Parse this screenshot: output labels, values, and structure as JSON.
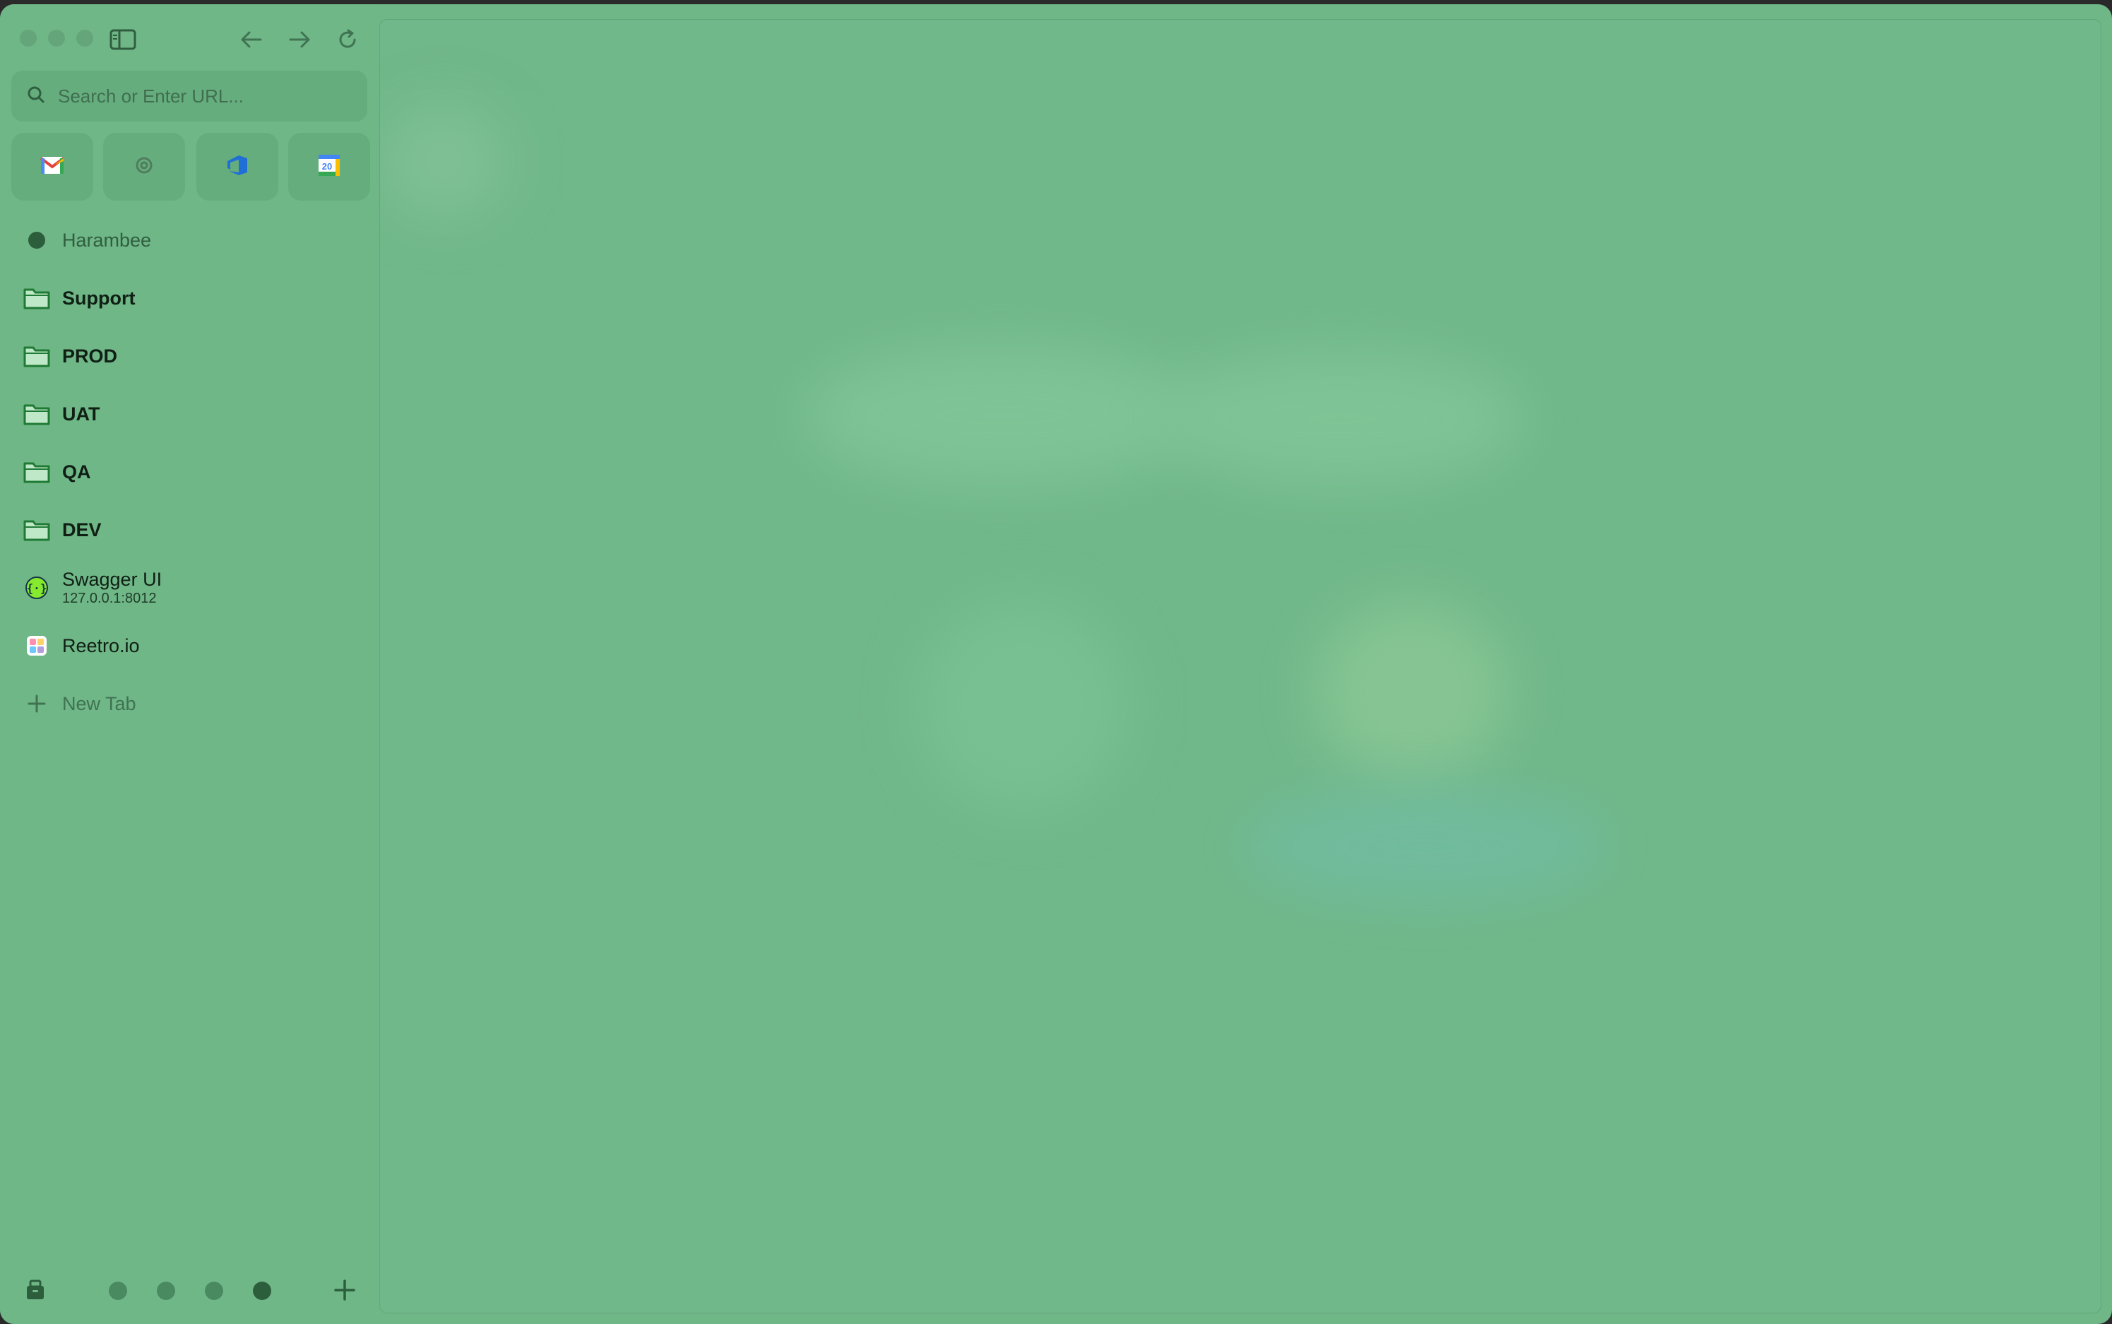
{
  "search": {
    "placeholder": "Search or Enter URL..."
  },
  "sidebar": {
    "items": [
      {
        "label": "Harambee",
        "icon": "space-dot-icon"
      },
      {
        "label": "Support",
        "icon": "folder-icon"
      },
      {
        "label": "PROD",
        "icon": "folder-icon"
      },
      {
        "label": "UAT",
        "icon": "folder-icon"
      },
      {
        "label": "QA",
        "icon": "folder-icon"
      },
      {
        "label": "DEV",
        "icon": "folder-icon"
      },
      {
        "label": "Swagger UI",
        "sublabel": "127.0.0.1:8012",
        "icon": "swagger-icon"
      },
      {
        "label": "Reetro.io",
        "icon": "reetro-icon"
      },
      {
        "label": "New Tab",
        "icon": "plus-icon"
      }
    ]
  },
  "pinned": [
    {
      "name": "gmail-icon"
    },
    {
      "name": "settings-icon"
    },
    {
      "name": "azure-devops-icon"
    },
    {
      "name": "calendar-icon",
      "text": "20"
    }
  ],
  "colors": {
    "sidebar_bg": "#70b788",
    "folder_border": "#1f7a34",
    "folder_fill": "#bfe8c9"
  }
}
